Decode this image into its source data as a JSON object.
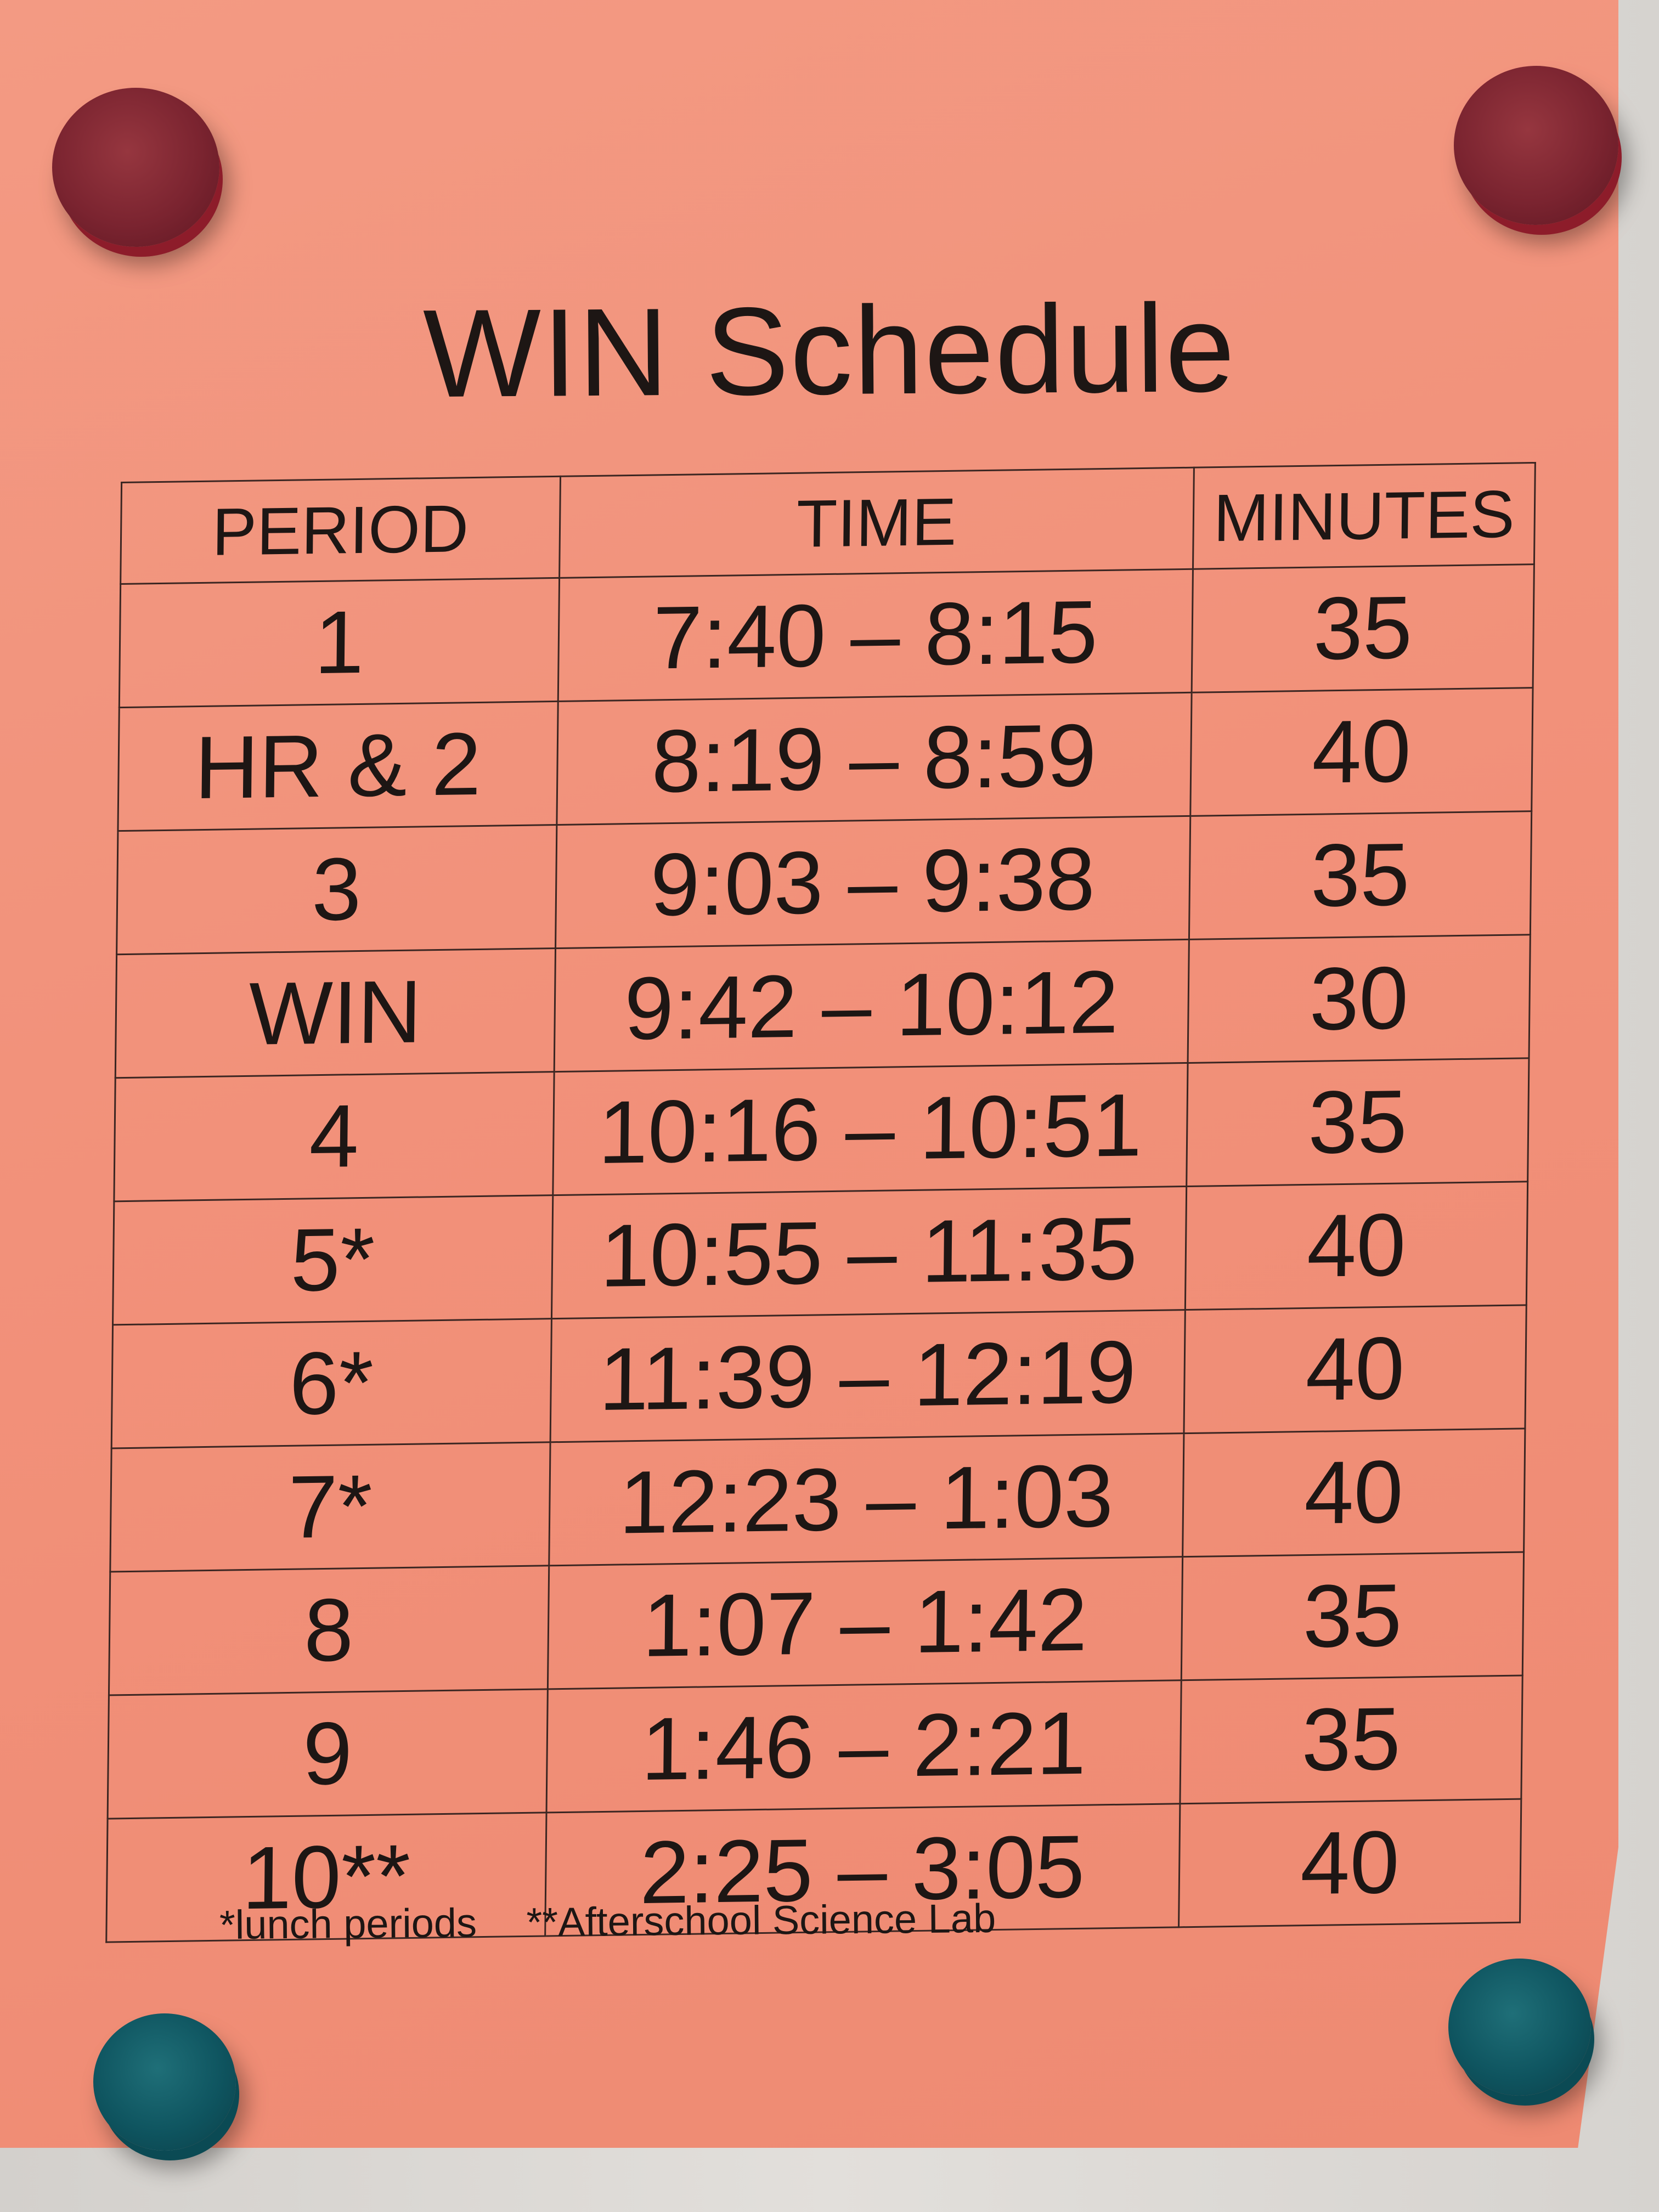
{
  "title": "WIN Schedule",
  "table": {
    "headers": [
      "PERIOD",
      "TIME",
      "MINUTES"
    ],
    "rows": [
      {
        "period": "1",
        "time": "7:40 – 8:15",
        "minutes": "35"
      },
      {
        "period": "HR & 2",
        "time": "8:19 – 8:59",
        "minutes": "40"
      },
      {
        "period": "3",
        "time": "9:03 – 9:38",
        "minutes": "35"
      },
      {
        "period": "WIN",
        "time": "9:42 – 10:12",
        "minutes": "30"
      },
      {
        "period": "4",
        "time": "10:16 – 10:51",
        "minutes": "35"
      },
      {
        "period": "5*",
        "time": "10:55 – 11:35",
        "minutes": "40"
      },
      {
        "period": "6*",
        "time": "11:39 – 12:19",
        "minutes": "40"
      },
      {
        "period": "7*",
        "time": "12:23 – 1:03",
        "minutes": "40"
      },
      {
        "period": "8",
        "time": "1:07 – 1:42",
        "minutes": "35"
      },
      {
        "period": "9",
        "time": "1:46 – 2:21",
        "minutes": "35"
      },
      {
        "period": "10**",
        "time": "2:25 – 3:05",
        "minutes": "40"
      }
    ]
  },
  "footnotes": {
    "lunch": "*lunch periods",
    "afterschool": "**Afterschool Science Lab"
  },
  "colors": {
    "paper": "#f2917a",
    "ink": "#1d1614",
    "magnet_red": "#7b2430",
    "magnet_teal": "#0f5560"
  }
}
